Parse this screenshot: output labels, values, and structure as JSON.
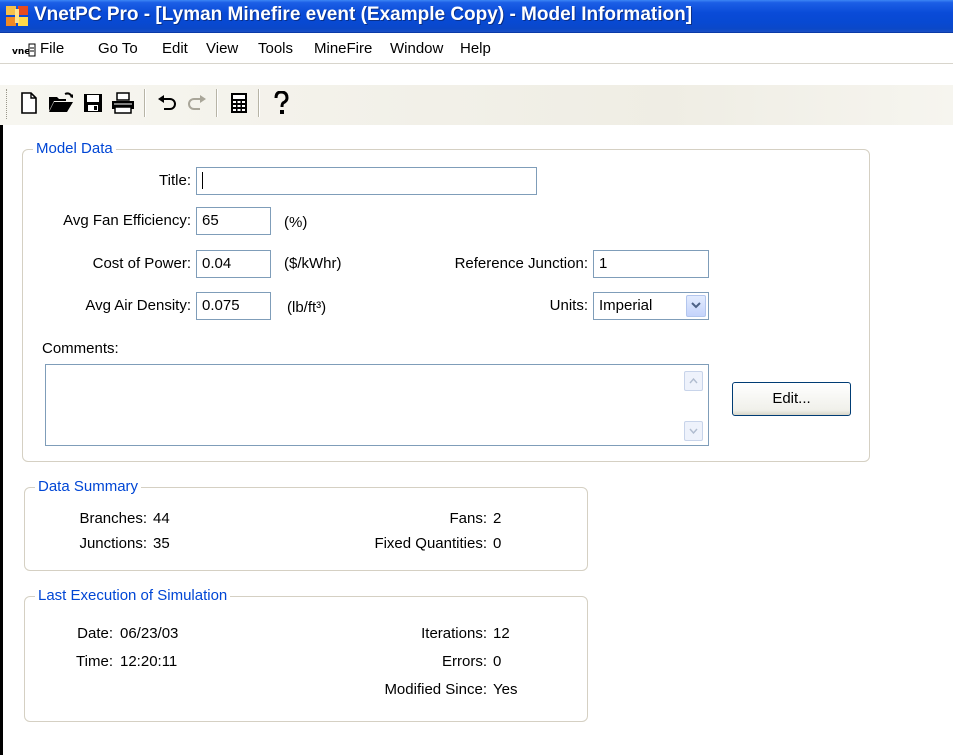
{
  "window": {
    "title": "VnetPC Pro - [Lyman Minefire event (Example Copy) - Model Information]"
  },
  "menu": {
    "items": [
      "File",
      "Go To",
      "Edit",
      "View",
      "Tools",
      "MineFire",
      "Window",
      "Help"
    ]
  },
  "toolbar": {
    "buttons": [
      "new-icon",
      "open-icon",
      "save-icon",
      "print-icon",
      "undo-icon",
      "redo-icon",
      "calculator-icon",
      "help-icon"
    ]
  },
  "model_data": {
    "group_label": "Model Data",
    "title_label": "Title:",
    "title_value": "",
    "fan_eff_label": "Avg Fan Efficiency:",
    "fan_eff_value": "65",
    "fan_eff_unit": "(%)",
    "cost_label": "Cost of Power:",
    "cost_value": "0.04",
    "cost_unit": "($/kWhr)",
    "ref_junction_label": "Reference Junction:",
    "ref_junction_value": "1",
    "density_label": "Avg Air Density:",
    "density_value": "0.075",
    "density_unit": "(lb/ft³)",
    "units_label": "Units:",
    "units_value": "Imperial",
    "comments_label": "Comments:",
    "comments_value": "",
    "edit_button": "Edit..."
  },
  "data_summary": {
    "group_label": "Data Summary",
    "branches_label": "Branches:",
    "branches_value": "44",
    "junctions_label": "Junctions:",
    "junctions_value": "35",
    "fans_label": "Fans:",
    "fans_value": "2",
    "fixed_label": "Fixed Quantities:",
    "fixed_value": "0"
  },
  "last_execution": {
    "group_label": "Last Execution of Simulation",
    "date_label": "Date:",
    "date_value": "06/23/03",
    "time_label": "Time:",
    "time_value": "12:20:11",
    "iterations_label": "Iterations:",
    "iterations_value": "12",
    "errors_label": "Errors:",
    "errors_value": "0",
    "modified_label": "Modified Since:",
    "modified_value": "Yes"
  },
  "colors": {
    "titlebar": "#0a4bd8",
    "group_label": "#0046d5",
    "field_border": "#7f9db9"
  }
}
